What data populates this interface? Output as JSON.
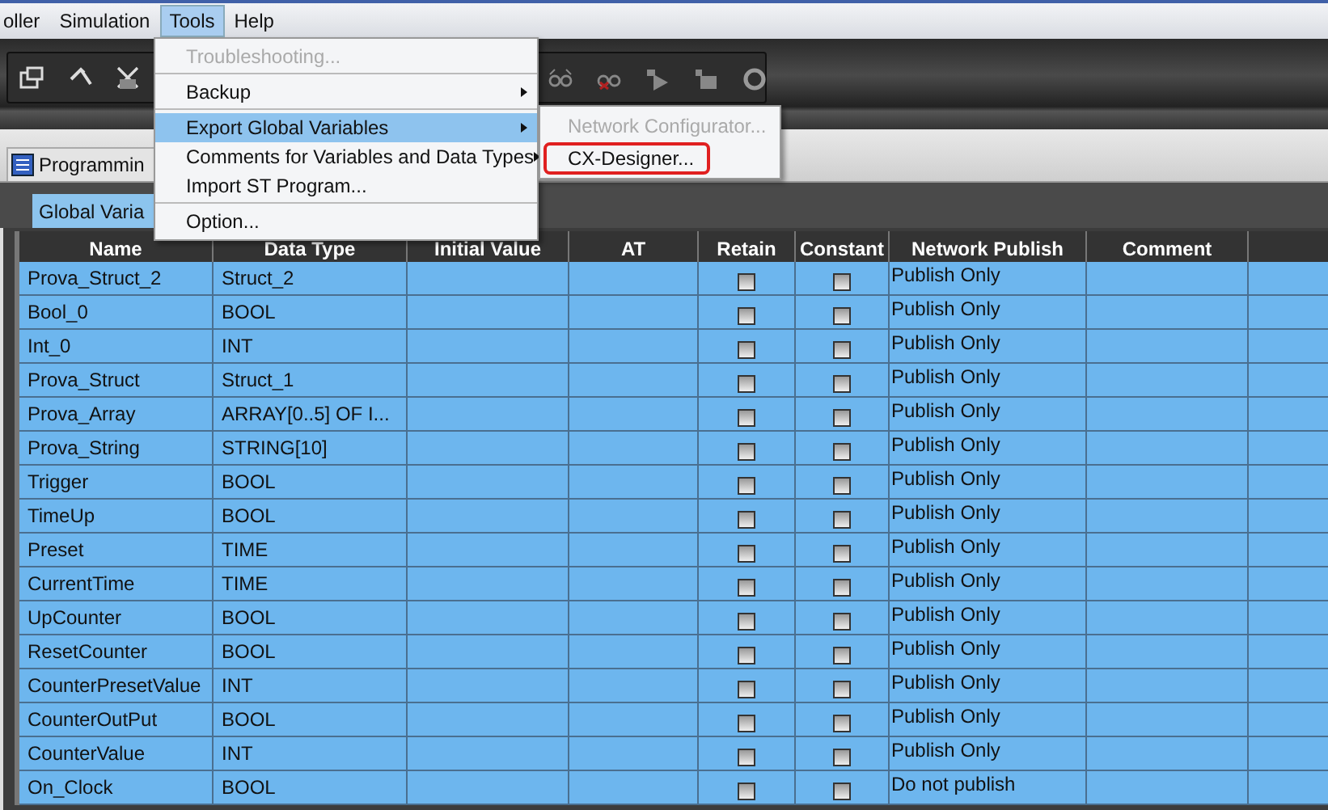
{
  "menubar": [
    {
      "label": "oller",
      "selected": false
    },
    {
      "label": "Simulation",
      "selected": false
    },
    {
      "label": "Tools",
      "selected": true
    },
    {
      "label": "Help",
      "selected": false
    }
  ],
  "editor_tab": {
    "label": "Programmin"
  },
  "sub_tab": {
    "label": "Global Varia",
    "selected": true
  },
  "table": {
    "columns": [
      "Name",
      "Data Type",
      "Initial Value",
      "AT",
      "Retain",
      "Constant",
      "Network Publish",
      "Comment"
    ],
    "rows": [
      {
        "name": "Prova_Struct_2",
        "data_type": "Struct_2",
        "retain": false,
        "constant": false,
        "network_publish": "Publish Only"
      },
      {
        "name": "Bool_0",
        "data_type": "BOOL",
        "retain": false,
        "constant": false,
        "network_publish": "Publish Only"
      },
      {
        "name": "Int_0",
        "data_type": "INT",
        "retain": false,
        "constant": false,
        "network_publish": "Publish Only"
      },
      {
        "name": "Prova_Struct",
        "data_type": "Struct_1",
        "retain": false,
        "constant": false,
        "network_publish": "Publish Only"
      },
      {
        "name": "Prova_Array",
        "data_type": "ARRAY[0..5] OF  I...",
        "retain": false,
        "constant": false,
        "network_publish": "Publish Only"
      },
      {
        "name": "Prova_String",
        "data_type": "STRING[10]",
        "retain": false,
        "constant": false,
        "network_publish": "Publish Only"
      },
      {
        "name": "Trigger",
        "data_type": "BOOL",
        "retain": false,
        "constant": false,
        "network_publish": "Publish Only"
      },
      {
        "name": "TimeUp",
        "data_type": "BOOL",
        "retain": false,
        "constant": false,
        "network_publish": "Publish Only"
      },
      {
        "name": "Preset",
        "data_type": "TIME",
        "retain": false,
        "constant": false,
        "network_publish": "Publish Only"
      },
      {
        "name": "CurrentTime",
        "data_type": "TIME",
        "retain": false,
        "constant": false,
        "network_publish": "Publish Only"
      },
      {
        "name": "UpCounter",
        "data_type": "BOOL",
        "retain": false,
        "constant": false,
        "network_publish": "Publish Only"
      },
      {
        "name": "ResetCounter",
        "data_type": "BOOL",
        "retain": false,
        "constant": false,
        "network_publish": "Publish Only"
      },
      {
        "name": "CounterPresetValue",
        "data_type": "INT",
        "retain": false,
        "constant": false,
        "network_publish": "Publish Only"
      },
      {
        "name": "CounterOutPut",
        "data_type": "BOOL",
        "retain": false,
        "constant": false,
        "network_publish": "Publish Only"
      },
      {
        "name": "CounterValue",
        "data_type": "INT",
        "retain": false,
        "constant": false,
        "network_publish": "Publish Only"
      },
      {
        "name": "On_Clock",
        "data_type": "BOOL",
        "retain": false,
        "constant": false,
        "network_publish": "Do not publish"
      }
    ]
  },
  "tools_menu": {
    "items": [
      {
        "kind": "item",
        "label": "Troubleshooting...",
        "disabled": true,
        "selected": false,
        "submenu": false
      },
      {
        "kind": "separator"
      },
      {
        "kind": "item",
        "label": "Backup",
        "disabled": false,
        "selected": false,
        "submenu": true
      },
      {
        "kind": "separator"
      },
      {
        "kind": "item",
        "label": "Export Global Variables",
        "disabled": false,
        "selected": true,
        "submenu": true
      },
      {
        "kind": "item",
        "label": "Comments for Variables and Data Types",
        "disabled": false,
        "selected": false,
        "submenu": true
      },
      {
        "kind": "item",
        "label": "Import ST Program...",
        "disabled": false,
        "selected": false,
        "submenu": false
      },
      {
        "kind": "separator"
      },
      {
        "kind": "item",
        "label": "Option...",
        "disabled": false,
        "selected": false,
        "submenu": false
      }
    ]
  },
  "submenu": {
    "items": [
      {
        "label": "Network Configurator...",
        "disabled": true,
        "highlighted": false
      },
      {
        "label": "CX-Designer...",
        "disabled": false,
        "highlighted": true
      }
    ]
  }
}
